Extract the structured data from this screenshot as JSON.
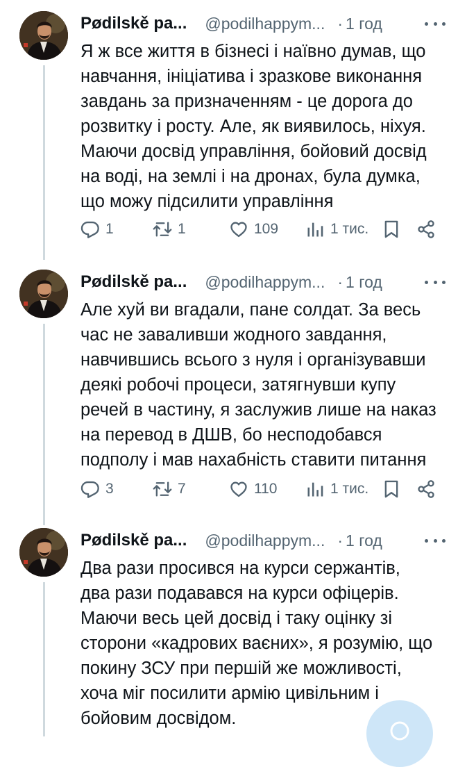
{
  "colors": {
    "text": "#0f1419",
    "secondary": "#536471",
    "thread_line": "#cfd9de",
    "fab": "#c6e2f7"
  },
  "icons": {
    "reply": "reply-icon",
    "repost": "repost-icon",
    "like": "like-icon",
    "views": "views-icon",
    "bookmark": "bookmark-icon",
    "share": "share-icon",
    "more": "more-icon",
    "compose": "compose-icon"
  },
  "tweets": [
    {
      "author_name": "Pødilskě pa...",
      "handle": "@podilhappym...",
      "separator": "·",
      "time": "1 год",
      "text_lines": [
        "Я ж все життя в бізнесі і наївно думав, що",
        "навчання, ініціатива і зразкове виконання",
        "завдань за призначенням - це дорога до",
        "розвитку і росту. Але, як виявилось, ніхуя.",
        "Маючи досвід управління, бойовий досвід",
        "на воді, на землі і на дронах, була думка,",
        "що можу підсилити управління"
      ],
      "replies": "1",
      "reposts": "1",
      "likes": "109",
      "views": "1 тис."
    },
    {
      "author_name": "Pødilskě pa...",
      "handle": "@podilhappym...",
      "separator": "·",
      "time": "1 год",
      "text_lines": [
        "Але хуй ви вгадали, пане солдат. За весь",
        "час не заваливши жодного завдання,",
        "навчившись всього з нуля і організувавши",
        "деякі робочі процеси, затягнувши купу",
        "речей в частину, я заслужив лише на наказ",
        "на перевод в ДШВ, бо несподобався",
        "подполу і мав нахабність ставити питання"
      ],
      "replies": "3",
      "reposts": "7",
      "likes": "110",
      "views": "1 тис."
    },
    {
      "author_name": "Pødilskě pa...",
      "handle": "@podilhappym...",
      "separator": "·",
      "time": "1 год",
      "text_lines": [
        "Два рази просився на курси сержантів,",
        "два рази подавався на курси офіцерів.",
        "Маючи весь цей досвід і таку оцінку зі",
        "сторони «кадрових ваєних», я розумію, що",
        "покину ЗСУ при першій же можливості,",
        "хоча міг посилити армію цивільним і",
        "бойовим досвідом."
      ]
    }
  ]
}
